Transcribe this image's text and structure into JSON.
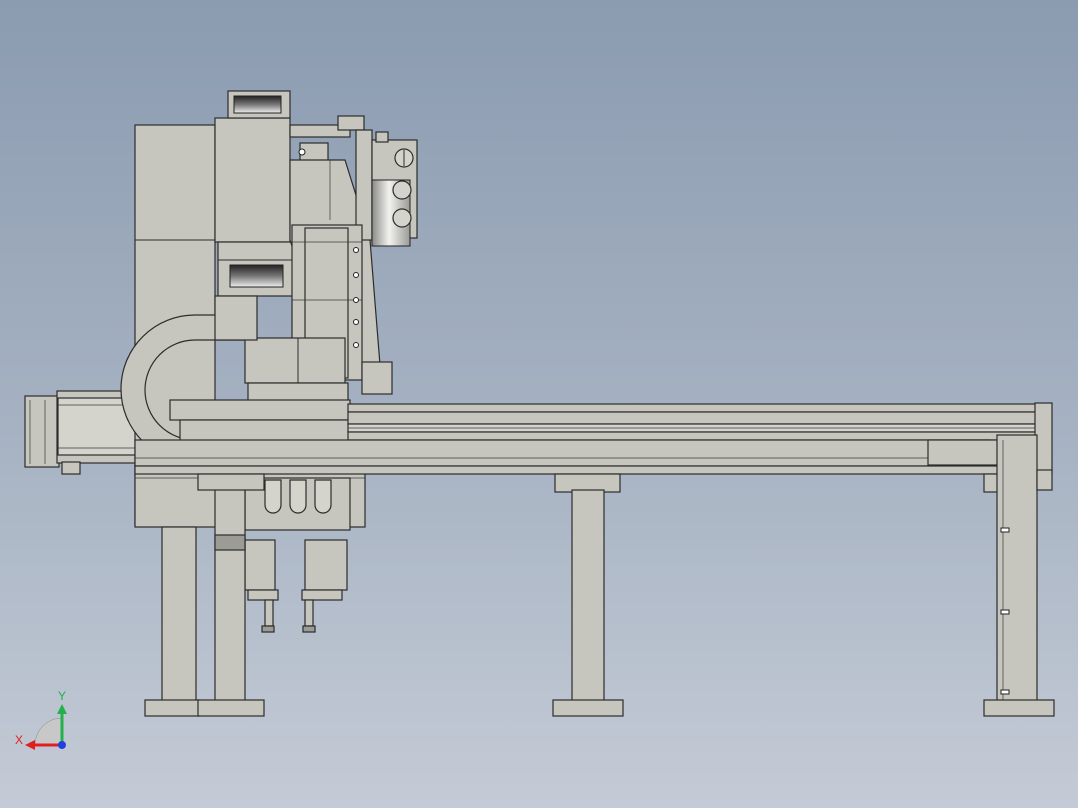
{
  "view": {
    "background_top": "#8b9bb0",
    "background_bottom": "#c4cbd6",
    "part_color": "#c6c6be"
  },
  "triad": {
    "y_label": "Y",
    "x_label": "X",
    "y_color": "#22b14c",
    "x_color": "#e02020",
    "z_color": "#2040e0"
  }
}
